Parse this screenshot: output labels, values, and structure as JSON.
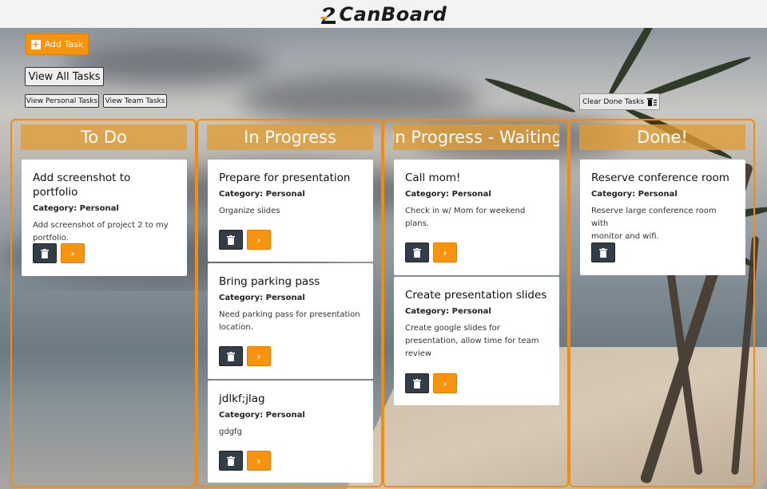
{
  "app": {
    "logo_text": "CanBoard"
  },
  "toolbar": {
    "add_task_label": "Add Task",
    "view_all_label": "View All Tasks",
    "view_personal_label": "View Personal Tasks",
    "view_team_label": "View Team Tasks",
    "clear_done_label": "Clear Done Tasks"
  },
  "colors": {
    "accent": "#f7930e",
    "header_fill": "#e29c33",
    "dark_button": "#333d47"
  },
  "columns": [
    {
      "title": "To Do",
      "cards": [
        {
          "title": "Add screenshot to portfolio",
          "category": "Category: Personal",
          "desc_lines": [
            "Add screenshot of project 2 to my",
            "portfolio."
          ]
        }
      ]
    },
    {
      "title": "In Progress",
      "cards": [
        {
          "title": "Prepare for presentation",
          "category": "Category: Personal",
          "desc_lines": [
            "Organize slides"
          ]
        },
        {
          "title": "Bring parking pass",
          "category": "Category: Personal",
          "desc_lines": [
            "Need parking pass for presentation",
            "location."
          ]
        },
        {
          "title": "jdlkf;jlag",
          "category": "Category: Personal",
          "desc_lines": [
            "gdgfg"
          ]
        }
      ]
    },
    {
      "title": "In Progress - Waiting",
      "cards": [
        {
          "title": "Call mom!",
          "category": "Category: Personal",
          "desc_lines": [
            "Check in w/ Mom for weekend",
            "plans."
          ]
        },
        {
          "title": "Create presentation slides",
          "category": "Category: Personal",
          "desc_lines": [
            "Create google slides for",
            "presentation, allow time for team",
            "review"
          ]
        }
      ]
    },
    {
      "title": "Done!",
      "cards": [
        {
          "title": "Reserve conference room",
          "category": "Category: Personal",
          "desc_lines": [
            "Reserve large conference room with",
            "monitor and wifi."
          ]
        }
      ]
    }
  ]
}
